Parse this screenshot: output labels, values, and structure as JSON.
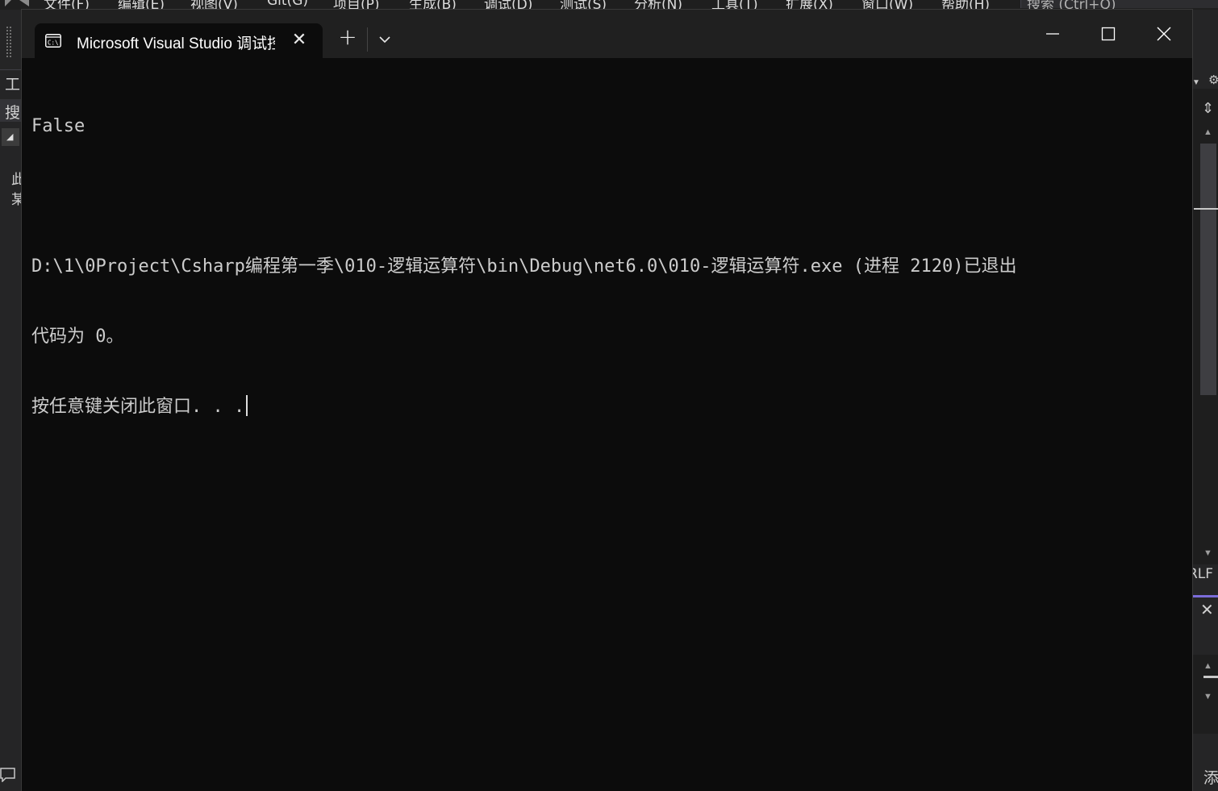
{
  "vs_menu": {
    "items": [
      "文件(F)",
      "编辑(E)",
      "视图(V)",
      "Git(G)",
      "项目(P)",
      "生成(B)",
      "调试(D)",
      "测试(S)",
      "分析(N)",
      "工具(T)",
      "扩展(X)",
      "窗口(W)",
      "帮助(H)"
    ],
    "search_placeholder": "搜索 (Ctrl+Q)"
  },
  "vs_left": {
    "toolbox_label": "工",
    "search_label": "搜",
    "text_1": "此",
    "text_2": "某"
  },
  "vs_right": {
    "line_ending": "RLF",
    "add_label": "添"
  },
  "terminal": {
    "tab_title": "Microsoft Visual Studio 调试控制台",
    "tab_icon": "console-icon",
    "new_tab_label": "+",
    "window_controls": [
      "minimize-icon",
      "maximize-icon",
      "close-icon"
    ],
    "output": {
      "line1": "False",
      "line2": "",
      "line3": "D:\\1\\0Project\\Csharp编程第一季\\010-逻辑运算符\\bin\\Debug\\net6.0\\010-逻辑运算符.exe (进程 2120)已退出",
      "line4": "代码为 0。",
      "line5": "按任意键关闭此窗口. . ."
    },
    "colors": {
      "background": "#0c0c0c",
      "tabstrip": "#202020",
      "text": "#cccccc"
    }
  }
}
